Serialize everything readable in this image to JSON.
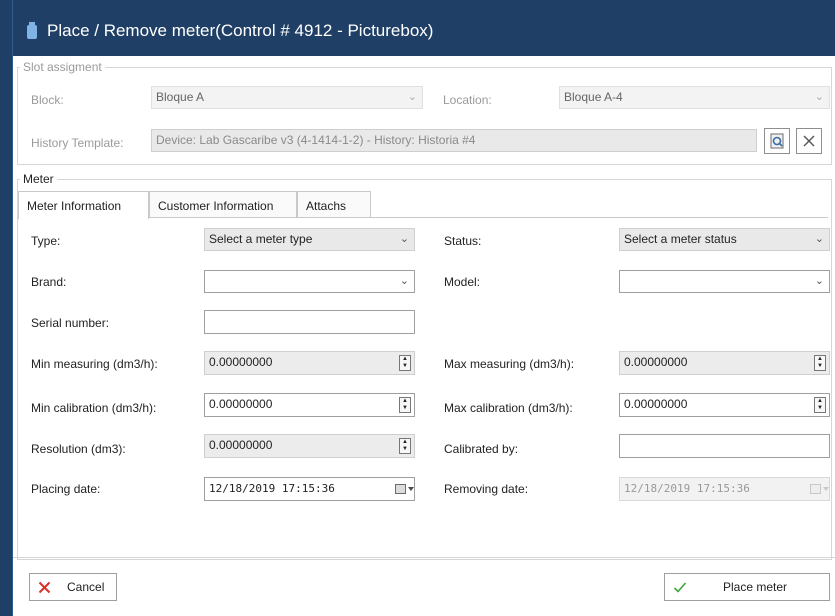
{
  "window": {
    "title": "Place / Remove meter(Control # 4912 - Picturebox)"
  },
  "slot": {
    "legend": "Slot assigment",
    "block_label": "Block:",
    "block_value": "Bloque A",
    "location_label": "Location:",
    "location_value": "Bloque A-4",
    "history_label": "History Template:",
    "history_value": "Device: Lab Gascaribe v3 (4-1414-1-2) - History: Historia #4"
  },
  "meter": {
    "legend": "Meter",
    "tabs": [
      {
        "label": "Meter Information"
      },
      {
        "label": "Customer Information"
      },
      {
        "label": "Attachs"
      }
    ],
    "type_label": "Type:",
    "type_value": "Select a meter type",
    "status_label": "Status:",
    "status_value": "Select a meter status",
    "brand_label": "Brand:",
    "brand_value": "",
    "model_label": "Model:",
    "model_value": "",
    "serial_label": "Serial number:",
    "serial_value": "",
    "min_measuring_label": "Min measuring (dm3/h):",
    "min_measuring_value": "0.00000000",
    "max_measuring_label": "Max measuring (dm3/h):",
    "max_measuring_value": "0.00000000",
    "min_calibration_label": "Min calibration (dm3/h):",
    "min_calibration_value": "0.00000000",
    "max_calibration_label": "Max calibration (dm3/h):",
    "max_calibration_value": "0.00000000",
    "resolution_label": "Resolution (dm3):",
    "resolution_value": "0.00000000",
    "calibrated_by_label": "Calibrated by:",
    "calibrated_by_value": "",
    "placing_date_label": "Placing date:",
    "placing_date_value": "12/18/2019 17:15:36",
    "removing_date_label": "Removing date:",
    "removing_date_value": "12/18/2019 17:15:36"
  },
  "footer": {
    "cancel_label": "Cancel",
    "place_label": "Place meter"
  },
  "icons": {
    "window": "meter-app-icon",
    "chevron": "chevron-down-icon",
    "search": "search-icon",
    "clear": "close-icon",
    "spin": "spin-buttons-icon",
    "calendar": "calendar-icon",
    "cancel": "x-icon",
    "confirm": "check-icon"
  },
  "colors": {
    "titlebar": "#1f3f66",
    "cancel_icon": "#d9302a",
    "confirm_icon": "#3aa83a"
  }
}
